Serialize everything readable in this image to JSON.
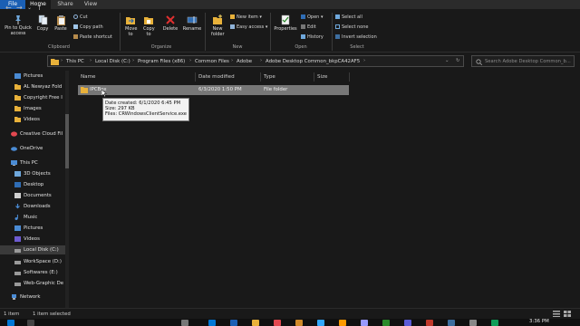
{
  "ribbon": {
    "tabs": [
      "File",
      "Home",
      "Share",
      "View"
    ],
    "clipboard": {
      "pin": "Pin to Quick access",
      "copy": "Copy",
      "paste": "Paste",
      "cut": "Cut",
      "copy_path": "Copy path",
      "paste_shortcut": "Paste shortcut",
      "label": "Clipboard"
    },
    "organize": {
      "move_to": "Move to",
      "copy_to": "Copy to",
      "delete": "Delete",
      "rename": "Rename",
      "label": "Organize"
    },
    "new": {
      "new_folder": "New folder",
      "new_item": "New item",
      "easy_access": "Easy access",
      "label": "New"
    },
    "open": {
      "properties": "Properties",
      "open": "Open",
      "edit": "Edit",
      "history": "History",
      "label": "Open"
    },
    "select": {
      "select_all": "Select all",
      "select_none": "Select none",
      "invert_selection": "Invert selection",
      "label": "Select"
    }
  },
  "address": {
    "crumbs": [
      "This PC",
      "Local Disk (C:)",
      "Program Files (x86)",
      "Common Files",
      "Adobe",
      "Adobe Desktop Common_bkpCA42AF5"
    ],
    "search_placeholder": "Search Adobe Desktop Common_b..."
  },
  "navpane": {
    "items": [
      {
        "label": "Pictures",
        "icon": "pictures-folder-icon"
      },
      {
        "label": "AL Newyaz Fold",
        "icon": "folder-icon"
      },
      {
        "label": "Copyright Free I",
        "icon": "folder-icon"
      },
      {
        "label": "Images",
        "icon": "folder-icon"
      },
      {
        "label": "Videos",
        "icon": "folder-icon"
      },
      {
        "label": "Creative Cloud Fil",
        "icon": "creative-cloud-icon"
      },
      {
        "label": "OneDrive",
        "icon": "onedrive-icon"
      },
      {
        "label": "This PC",
        "icon": "computer-icon"
      },
      {
        "label": "3D Objects",
        "icon": "3d-objects-icon"
      },
      {
        "label": "Desktop",
        "icon": "desktop-icon"
      },
      {
        "label": "Documents",
        "icon": "documents-icon"
      },
      {
        "label": "Downloads",
        "icon": "downloads-icon"
      },
      {
        "label": "Music",
        "icon": "music-icon"
      },
      {
        "label": "Pictures",
        "icon": "pictures-folder-icon"
      },
      {
        "label": "Videos",
        "icon": "videos-icon"
      },
      {
        "label": "Local Disk (C:)",
        "icon": "drive-icon"
      },
      {
        "label": "WorkSpace (D:)",
        "icon": "drive-icon"
      },
      {
        "label": "Softwares (E:)",
        "icon": "drive-icon"
      },
      {
        "label": "Web-Graphic De",
        "icon": "drive-icon"
      },
      {
        "label": "Network",
        "icon": "network-icon"
      }
    ]
  },
  "columns": {
    "name": "Name",
    "date": "Date modified",
    "type": "Type",
    "size": "Size"
  },
  "files": [
    {
      "name": "IPCBox",
      "date": "6/3/2020 1:50 PM",
      "type": "File folder",
      "size": ""
    }
  ],
  "tooltip": {
    "line1": "Date created: 6/1/2020 6:45 PM",
    "line2": "Size: 297 KB",
    "line3": "Files: CRWindowsClientService.exe"
  },
  "status": {
    "count": "1 item",
    "selected": "1 item selected"
  },
  "clock": "3:36 PM",
  "colors": {
    "background": "#191919",
    "file_tab": "#1a5fb4",
    "selected_row": "#777777",
    "folder": "#e8b13a"
  }
}
